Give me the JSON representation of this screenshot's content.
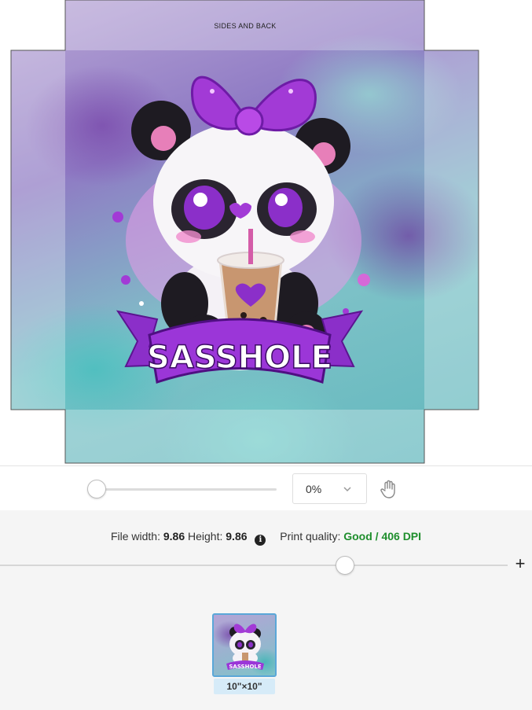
{
  "canvas": {
    "sides_label": "SIDES AND BACK",
    "banner_text": "SASSHOLE"
  },
  "zoom": {
    "value": "0%",
    "slider_level_percent": 0
  },
  "info": {
    "file_width_label": "File width:",
    "file_width_value": "9.86",
    "height_label": "Height:",
    "height_value": "9.86",
    "print_quality_label": "Print quality:",
    "print_quality_value": "Good / 406 DPI",
    "size_slider_level_percent": 68
  },
  "thumbnails": [
    {
      "label": "10\"×10\"",
      "banner_text": "SASSHOLE",
      "selected": true
    }
  ],
  "colors": {
    "quality_good": "#1e8e2c",
    "bow_purple": "#a23ad6",
    "banner_purple": "#8b2fc9",
    "selected_border": "#5aa7d8"
  },
  "icons": {
    "info": "info-icon",
    "hand": "hand-icon",
    "chevron": "chevron-down-icon",
    "plus": "plus-icon"
  }
}
